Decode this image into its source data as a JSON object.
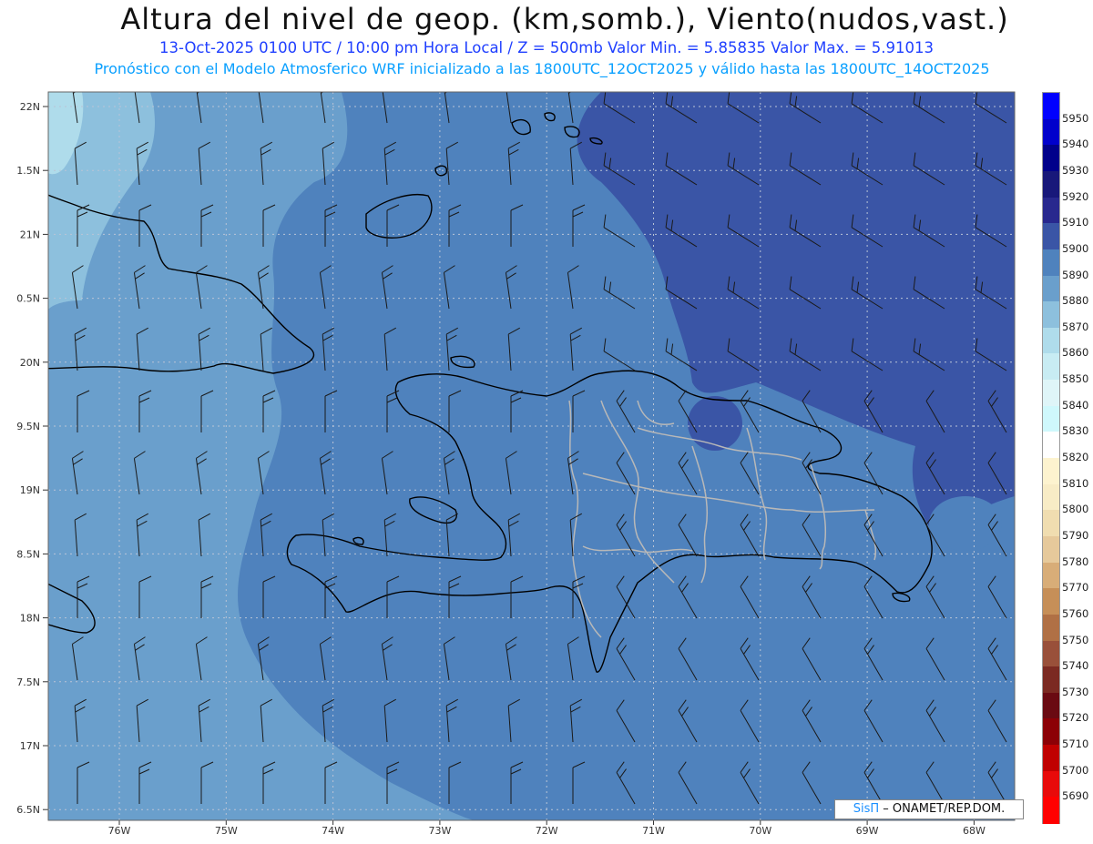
{
  "header": {
    "title": "Altura del nivel de geop. (km,somb.), Viento(nudos,vast.)",
    "subtitle": "13-Oct-2025  0100 UTC / 10:00 pm Hora Local / Z = 500mb    Valor Min. = 5.85835  Valor Max. = 5.91013",
    "model_line": "Pronóstico con el Modelo Atmosferico WRF inicializado a las 1800UTC_12OCT2025 y válido hasta las  1800UTC_14OCT2025"
  },
  "axes": {
    "lat_labels": [
      "22N",
      "1.5N",
      "21N",
      "0.5N",
      "20N",
      "9.5N",
      "19N",
      "8.5N",
      "18N",
      "7.5N",
      "17N",
      "6.5N"
    ],
    "lon_labels": [
      "76W",
      "75W",
      "74W",
      "73W",
      "72W",
      "71W",
      "70W",
      "69W",
      "68W"
    ]
  },
  "colorbar": {
    "levels": [
      "5950",
      "5940",
      "5930",
      "5920",
      "5910",
      "5900",
      "5890",
      "5880",
      "5870",
      "5860",
      "5850",
      "5840",
      "5830",
      "5820",
      "5810",
      "5800",
      "5790",
      "5780",
      "5770",
      "5760",
      "5750",
      "5740",
      "5730",
      "5720",
      "5710",
      "5700",
      "5690"
    ],
    "colors": [
      "#0000ff",
      "#0000cc",
      "#00008b",
      "#18187a",
      "#28288e",
      "#3a55a6",
      "#4f82bd",
      "#6a9fcc",
      "#8dc0dd",
      "#afdceb",
      "#c8ecf3",
      "#dff5f8",
      "#cff8fc",
      "#ffffff",
      "#fdf3cf",
      "#f8ecc6",
      "#f0ddb0",
      "#e6c99b",
      "#d8ad78",
      "#c68f58",
      "#b07045",
      "#99503a",
      "#7b2a22",
      "#6a0a12",
      "#8c0006",
      "#c00000",
      "#e80a0a",
      "#ff0000"
    ]
  },
  "credit": {
    "brand": "SisΠ",
    "rest": " – ONAMET/REP.DOM."
  }
}
